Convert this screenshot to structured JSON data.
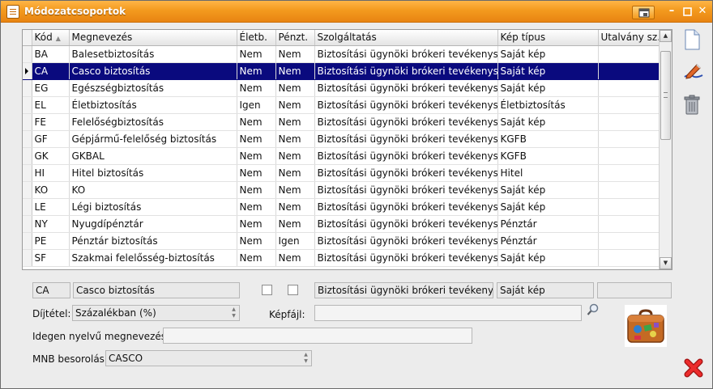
{
  "window": {
    "title": "Módozatcsoportok"
  },
  "grid": {
    "columns": [
      "Kód",
      "Megnevezés",
      "Életb.",
      "Pénzt.",
      "Szolgáltatás",
      "Kép típus",
      "Utalvány sz."
    ],
    "rows": [
      [
        "BA",
        "Balesetbiztosítás",
        "Nem",
        "Nem",
        "Biztosítási ügynöki brókeri tevékenység",
        "Saját kép",
        ""
      ],
      [
        "CA",
        "Casco biztosítás",
        "Nem",
        "Nem",
        "Biztosítási ügynöki brókeri tevékenység",
        "Saját kép",
        ""
      ],
      [
        "EG",
        "Egészségbiztosítás",
        "Nem",
        "Nem",
        "Biztosítási ügynöki brókeri tevékenység",
        "Saját kép",
        ""
      ],
      [
        "EL",
        "Életbiztosítás",
        "Igen",
        "Nem",
        "Biztosítási ügynöki brókeri tevékenység",
        "Életbiztosítás",
        ""
      ],
      [
        "FE",
        "Felelőségbiztosítás",
        "Nem",
        "Nem",
        "Biztosítási ügynöki brókeri tevékenység",
        "Saját kép",
        ""
      ],
      [
        "GF",
        "Gépjármű-felelőség biztosítás",
        "Nem",
        "Nem",
        "Biztosítási ügynöki brókeri tevékenység",
        "KGFB",
        ""
      ],
      [
        "GK",
        "GKBAL",
        "Nem",
        "Nem",
        "Biztosítási ügynöki brókeri tevékenység",
        "KGFB",
        ""
      ],
      [
        "HI",
        "Hitel biztosítás",
        "Nem",
        "Nem",
        "Biztosítási ügynöki brókeri tevékenység",
        "Hitel",
        ""
      ],
      [
        "KO",
        "KO",
        "Nem",
        "Nem",
        "Biztosítási ügynöki brókeri tevékenység",
        "Saját kép",
        ""
      ],
      [
        "LE",
        "Légi biztosítás",
        "Nem",
        "Nem",
        "Biztosítási ügynöki brókeri tevékenység",
        "Saját kép",
        ""
      ],
      [
        "NY",
        "Nyugdípénztár",
        "Nem",
        "Nem",
        "Biztosítási ügynöki brókeri tevékenység",
        "Pénztár",
        ""
      ],
      [
        "PE",
        "Pénztár biztosítás",
        "Nem",
        "Igen",
        "Biztosítási ügynöki brókeri tevékenység",
        "Pénztár",
        ""
      ],
      [
        "SF",
        "Szakmai felelősség-biztosítás",
        "Nem",
        "Nem",
        "Biztosítási ügynöki brókeri tevékenység",
        "Saját kép",
        ""
      ]
    ],
    "selected_index": 1
  },
  "detail": {
    "code": "CA",
    "name": "Casco biztosítás",
    "service": "Biztosítási ügynöki brókeri tevékenység",
    "image_type": "Saját kép",
    "voucher": "",
    "fee_label": "Díjtétel:",
    "fee_value": "Százalékban (%)",
    "image_file_label": "Képfájl:",
    "image_file_value": "",
    "foreign_name_label": "Idegen nyelvű megnevezés:",
    "foreign_name_value": "",
    "mnb_label": "MNB besorolás:",
    "mnb_value": "CASCO"
  },
  "icons": [
    "window-icon",
    "restore-icon",
    "minimize-icon",
    "maximize-icon",
    "close-icon",
    "new-document-icon",
    "edit-pencil-icon",
    "trash-icon",
    "magnifier-icon",
    "suitcase-image",
    "delete-x-icon"
  ],
  "colors": {
    "titlebar": "#f39a1e",
    "selection": "#0a0a7e",
    "delete": "#e02020"
  }
}
